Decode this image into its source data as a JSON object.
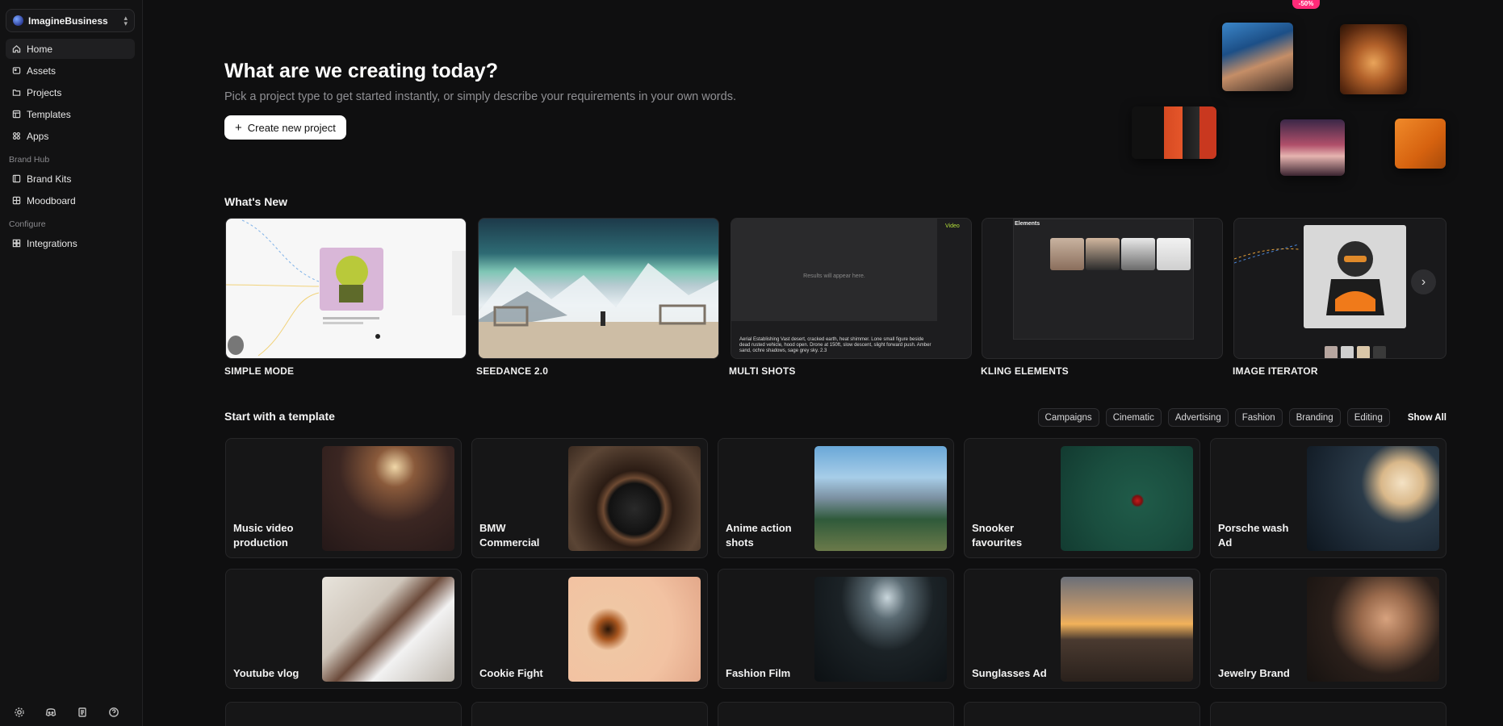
{
  "workspace": {
    "name": "ImagineBusiness"
  },
  "sidebar": {
    "items": [
      {
        "label": "Home",
        "icon": "home-icon"
      },
      {
        "label": "Assets",
        "icon": "assets-icon"
      },
      {
        "label": "Projects",
        "icon": "folder-icon"
      },
      {
        "label": "Templates",
        "icon": "templates-icon"
      },
      {
        "label": "Apps",
        "icon": "apps-icon"
      }
    ],
    "brand_hub": {
      "title": "Brand Hub",
      "items": [
        {
          "label": "Brand Kits",
          "icon": "brand-kit-icon"
        },
        {
          "label": "Moodboard",
          "icon": "moodboard-icon"
        }
      ]
    },
    "configure": {
      "title": "Configure",
      "items": [
        {
          "label": "Integrations",
          "icon": "integrations-icon"
        }
      ]
    },
    "bottom_icons": [
      "settings-icon",
      "discord-icon",
      "docs-icon",
      "help-icon"
    ]
  },
  "hero": {
    "title": "What are we creating today?",
    "subtitle": "Pick a project type to get started instantly, or simply describe your requirements in your own words.",
    "create_button": "Create new project",
    "badge": "-50%"
  },
  "whats_new": {
    "title": "What's New",
    "cards": [
      {
        "label": "SIMPLE MODE"
      },
      {
        "label": "SEEDANCE 2.0"
      },
      {
        "label": "MULTI SHOTS",
        "placeholder": "Results will appear here.",
        "tag": "Video",
        "prompt": "Aerial Establishing Vast desert, cracked earth, heat shimmer. Lone small figure beside dead rusted vehicle, hood open. Drone at 150ft, slow descent, slight forward push. Amber sand, ochre shadows, sage grey sky. 2.3"
      },
      {
        "label": "KLING ELEMENTS",
        "panel_title": "Elements"
      },
      {
        "label": "IMAGE ITERATOR"
      }
    ]
  },
  "templates": {
    "title": "Start with a template",
    "filters": [
      "Campaigns",
      "Cinematic",
      "Advertising",
      "Fashion",
      "Branding",
      "Editing"
    ],
    "show_all": "Show All",
    "items": [
      {
        "label": "Music video production"
      },
      {
        "label": "BMW Commercial"
      },
      {
        "label": "Anime action shots"
      },
      {
        "label": "Snooker favourites"
      },
      {
        "label": "Porsche wash Ad"
      },
      {
        "label": "Youtube vlog"
      },
      {
        "label": "Cookie Fight"
      },
      {
        "label": "Fashion Film"
      },
      {
        "label": "Sunglasses Ad"
      },
      {
        "label": "Jewelry Brand"
      }
    ]
  },
  "colors": {
    "background": "#0f0f10",
    "sidebar": "#121213",
    "accent_badge": "#ff2a78"
  }
}
